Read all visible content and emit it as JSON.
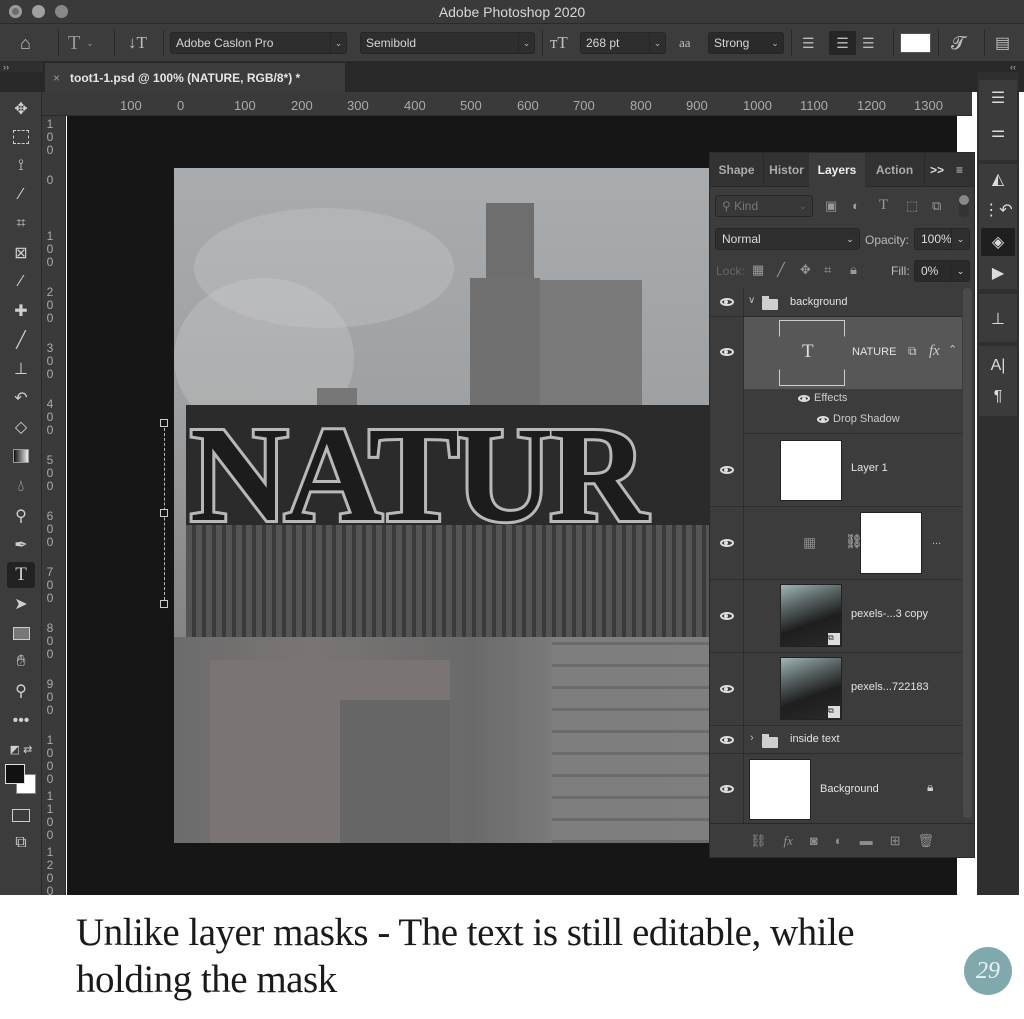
{
  "app": {
    "title": "Adobe Photoshop 2020"
  },
  "options_bar": {
    "font_family": "Adobe Caslon Pro",
    "font_style": "Semibold",
    "font_size": "268 pt",
    "antialias_icon": "aa",
    "antialias": "Strong",
    "text_color": "#ffffff",
    "alignment_selected": "center"
  },
  "document_tab": {
    "close": "×",
    "title": "toot1-1.psd @ 100% (NATURE, RGB/8*) *"
  },
  "rulers": {
    "horizontal": [
      "100",
      "0",
      "100",
      "200",
      "300",
      "400",
      "500",
      "600",
      "700",
      "800",
      "900",
      "1000",
      "1100",
      "1200",
      "1300"
    ],
    "vertical": [
      "100",
      "0",
      "100",
      "200",
      "300",
      "400",
      "500",
      "600",
      "700",
      "800",
      "900",
      "1000",
      "1100",
      "1200"
    ]
  },
  "canvas": {
    "text_layer_content": "NATUR"
  },
  "layers_panel": {
    "tabs": [
      "Shape",
      "Histor",
      "Layers",
      "Action"
    ],
    "active_tab": "Layers",
    "overflow": ">>",
    "filter_kind": "Kind",
    "blend_mode": "Normal",
    "opacity_label": "Opacity:",
    "opacity": "100%",
    "lock_label": "Lock:",
    "fill_label": "Fill:",
    "fill": "0%",
    "layers": [
      {
        "type": "group",
        "name": "background",
        "expanded": true,
        "visible": true
      },
      {
        "type": "text",
        "name": "NATURE",
        "visible": true,
        "selected": true,
        "fx": "fx"
      },
      {
        "type": "effects",
        "name": "Effects",
        "visible": true
      },
      {
        "type": "effect",
        "name": "Drop Shadow",
        "visible": true
      },
      {
        "type": "pixel",
        "name": "Layer 1",
        "visible": true
      },
      {
        "type": "adjustment",
        "name": "...",
        "visible": true
      },
      {
        "type": "smart-object",
        "name": "pexels-...3 copy",
        "visible": true
      },
      {
        "type": "smart-object",
        "name": "pexels...722183",
        "visible": true
      },
      {
        "type": "group",
        "name": "inside text",
        "expanded": false,
        "visible": true
      },
      {
        "type": "background",
        "name": "Background",
        "visible": true,
        "locked": true
      }
    ]
  },
  "footer": {
    "caption": "Unlike layer masks - The text is still editable, while holding the mask",
    "logo_text": "29",
    "logo_color": "#7fa9ad"
  }
}
